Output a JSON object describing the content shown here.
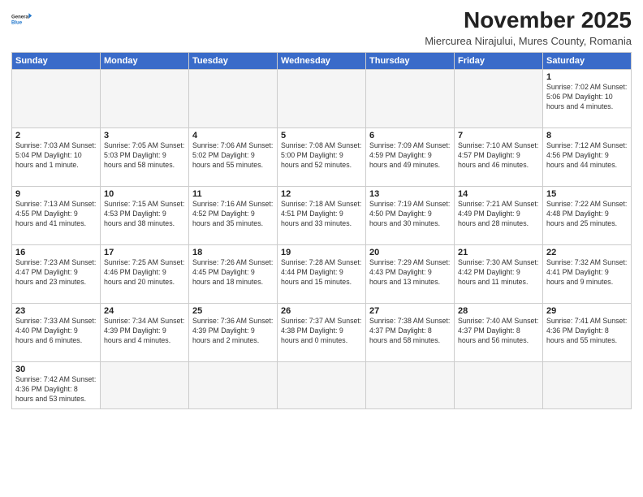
{
  "header": {
    "logo_general": "General",
    "logo_blue": "Blue",
    "month_title": "November 2025",
    "location": "Miercurea Nirajului, Mures County, Romania"
  },
  "days_of_week": [
    "Sunday",
    "Monday",
    "Tuesday",
    "Wednesday",
    "Thursday",
    "Friday",
    "Saturday"
  ],
  "weeks": [
    [
      {
        "day": "",
        "info": ""
      },
      {
        "day": "",
        "info": ""
      },
      {
        "day": "",
        "info": ""
      },
      {
        "day": "",
        "info": ""
      },
      {
        "day": "",
        "info": ""
      },
      {
        "day": "",
        "info": ""
      },
      {
        "day": "1",
        "info": "Sunrise: 7:02 AM\nSunset: 5:06 PM\nDaylight: 10 hours\nand 4 minutes."
      }
    ],
    [
      {
        "day": "2",
        "info": "Sunrise: 7:03 AM\nSunset: 5:04 PM\nDaylight: 10 hours\nand 1 minute."
      },
      {
        "day": "3",
        "info": "Sunrise: 7:05 AM\nSunset: 5:03 PM\nDaylight: 9 hours\nand 58 minutes."
      },
      {
        "day": "4",
        "info": "Sunrise: 7:06 AM\nSunset: 5:02 PM\nDaylight: 9 hours\nand 55 minutes."
      },
      {
        "day": "5",
        "info": "Sunrise: 7:08 AM\nSunset: 5:00 PM\nDaylight: 9 hours\nand 52 minutes."
      },
      {
        "day": "6",
        "info": "Sunrise: 7:09 AM\nSunset: 4:59 PM\nDaylight: 9 hours\nand 49 minutes."
      },
      {
        "day": "7",
        "info": "Sunrise: 7:10 AM\nSunset: 4:57 PM\nDaylight: 9 hours\nand 46 minutes."
      },
      {
        "day": "8",
        "info": "Sunrise: 7:12 AM\nSunset: 4:56 PM\nDaylight: 9 hours\nand 44 minutes."
      }
    ],
    [
      {
        "day": "9",
        "info": "Sunrise: 7:13 AM\nSunset: 4:55 PM\nDaylight: 9 hours\nand 41 minutes."
      },
      {
        "day": "10",
        "info": "Sunrise: 7:15 AM\nSunset: 4:53 PM\nDaylight: 9 hours\nand 38 minutes."
      },
      {
        "day": "11",
        "info": "Sunrise: 7:16 AM\nSunset: 4:52 PM\nDaylight: 9 hours\nand 35 minutes."
      },
      {
        "day": "12",
        "info": "Sunrise: 7:18 AM\nSunset: 4:51 PM\nDaylight: 9 hours\nand 33 minutes."
      },
      {
        "day": "13",
        "info": "Sunrise: 7:19 AM\nSunset: 4:50 PM\nDaylight: 9 hours\nand 30 minutes."
      },
      {
        "day": "14",
        "info": "Sunrise: 7:21 AM\nSunset: 4:49 PM\nDaylight: 9 hours\nand 28 minutes."
      },
      {
        "day": "15",
        "info": "Sunrise: 7:22 AM\nSunset: 4:48 PM\nDaylight: 9 hours\nand 25 minutes."
      }
    ],
    [
      {
        "day": "16",
        "info": "Sunrise: 7:23 AM\nSunset: 4:47 PM\nDaylight: 9 hours\nand 23 minutes."
      },
      {
        "day": "17",
        "info": "Sunrise: 7:25 AM\nSunset: 4:46 PM\nDaylight: 9 hours\nand 20 minutes."
      },
      {
        "day": "18",
        "info": "Sunrise: 7:26 AM\nSunset: 4:45 PM\nDaylight: 9 hours\nand 18 minutes."
      },
      {
        "day": "19",
        "info": "Sunrise: 7:28 AM\nSunset: 4:44 PM\nDaylight: 9 hours\nand 15 minutes."
      },
      {
        "day": "20",
        "info": "Sunrise: 7:29 AM\nSunset: 4:43 PM\nDaylight: 9 hours\nand 13 minutes."
      },
      {
        "day": "21",
        "info": "Sunrise: 7:30 AM\nSunset: 4:42 PM\nDaylight: 9 hours\nand 11 minutes."
      },
      {
        "day": "22",
        "info": "Sunrise: 7:32 AM\nSunset: 4:41 PM\nDaylight: 9 hours\nand 9 minutes."
      }
    ],
    [
      {
        "day": "23",
        "info": "Sunrise: 7:33 AM\nSunset: 4:40 PM\nDaylight: 9 hours\nand 6 minutes."
      },
      {
        "day": "24",
        "info": "Sunrise: 7:34 AM\nSunset: 4:39 PM\nDaylight: 9 hours\nand 4 minutes."
      },
      {
        "day": "25",
        "info": "Sunrise: 7:36 AM\nSunset: 4:39 PM\nDaylight: 9 hours\nand 2 minutes."
      },
      {
        "day": "26",
        "info": "Sunrise: 7:37 AM\nSunset: 4:38 PM\nDaylight: 9 hours\nand 0 minutes."
      },
      {
        "day": "27",
        "info": "Sunrise: 7:38 AM\nSunset: 4:37 PM\nDaylight: 8 hours\nand 58 minutes."
      },
      {
        "day": "28",
        "info": "Sunrise: 7:40 AM\nSunset: 4:37 PM\nDaylight: 8 hours\nand 56 minutes."
      },
      {
        "day": "29",
        "info": "Sunrise: 7:41 AM\nSunset: 4:36 PM\nDaylight: 8 hours\nand 55 minutes."
      }
    ],
    [
      {
        "day": "30",
        "info": "Sunrise: 7:42 AM\nSunset: 4:36 PM\nDaylight: 8 hours\nand 53 minutes."
      },
      {
        "day": "",
        "info": ""
      },
      {
        "day": "",
        "info": ""
      },
      {
        "day": "",
        "info": ""
      },
      {
        "day": "",
        "info": ""
      },
      {
        "day": "",
        "info": ""
      },
      {
        "day": "",
        "info": ""
      }
    ]
  ]
}
